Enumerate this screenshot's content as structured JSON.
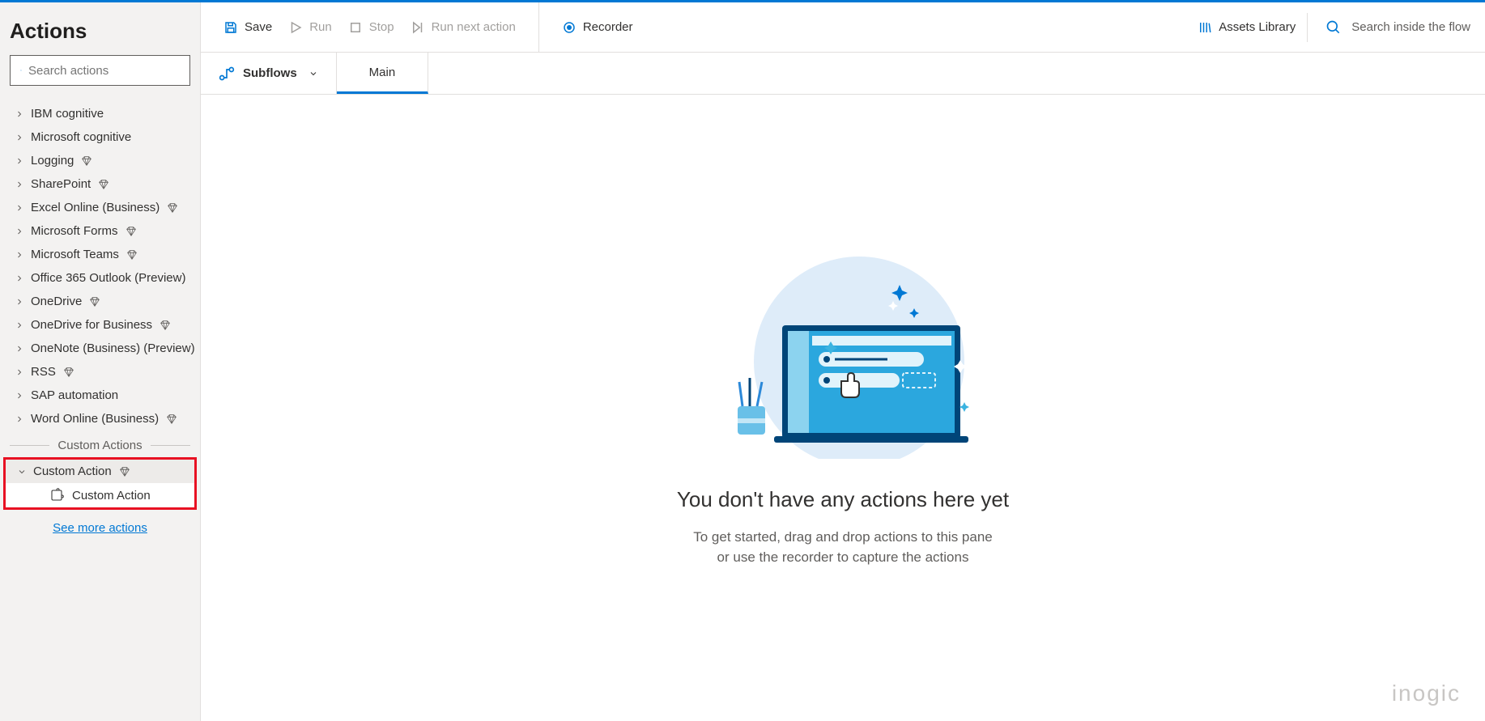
{
  "sidebar": {
    "title": "Actions",
    "search_placeholder": "Search actions",
    "categories": [
      {
        "label": "IBM cognitive",
        "premium": false,
        "expanded": false
      },
      {
        "label": "Microsoft cognitive",
        "premium": false,
        "expanded": false
      },
      {
        "label": "Logging",
        "premium": true,
        "expanded": false
      },
      {
        "label": "SharePoint",
        "premium": true,
        "expanded": false
      },
      {
        "label": "Excel Online (Business)",
        "premium": true,
        "expanded": false
      },
      {
        "label": "Microsoft Forms",
        "premium": true,
        "expanded": false
      },
      {
        "label": "Microsoft Teams",
        "premium": true,
        "expanded": false
      },
      {
        "label": "Office 365 Outlook (Preview)",
        "premium": false,
        "expanded": false
      },
      {
        "label": "OneDrive",
        "premium": true,
        "expanded": false
      },
      {
        "label": "OneDrive for Business",
        "premium": true,
        "expanded": false
      },
      {
        "label": "OneNote (Business) (Preview)",
        "premium": false,
        "expanded": false
      },
      {
        "label": "RSS",
        "premium": true,
        "expanded": false
      },
      {
        "label": "SAP automation",
        "premium": false,
        "expanded": false
      },
      {
        "label": "Word Online (Business)",
        "premium": true,
        "expanded": false
      }
    ],
    "custom_section_label": "Custom Actions",
    "custom_group": {
      "label": "Custom Action",
      "premium": true,
      "expanded": true,
      "child": "Custom Action"
    },
    "see_more": "See more actions"
  },
  "toolbar": {
    "save": "Save",
    "run": "Run",
    "stop": "Stop",
    "run_next": "Run next action",
    "recorder": "Recorder",
    "assets_library": "Assets Library",
    "search_placeholder": "Search inside the flow"
  },
  "tabs": {
    "subflows": "Subflows",
    "main": "Main"
  },
  "canvas": {
    "title": "You don't have any actions here yet",
    "subtitle_line1": "To get started, drag and drop actions to this pane",
    "subtitle_line2": "or use the recorder to capture the actions"
  },
  "watermark": "inogic"
}
